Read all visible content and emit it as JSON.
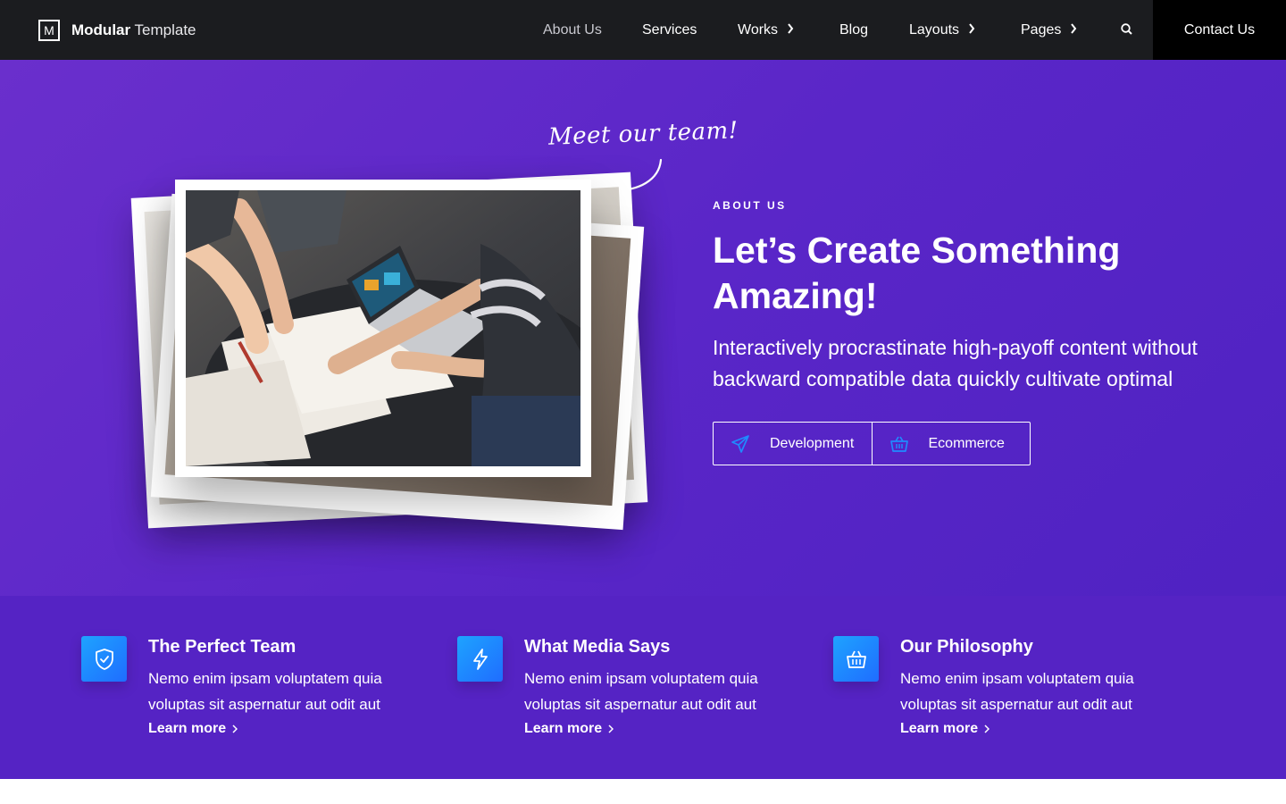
{
  "brand": {
    "logo_letter": "M",
    "name_bold": "Modular",
    "name_rest": " Template"
  },
  "nav": {
    "items": [
      {
        "label": "About Us",
        "has_submenu": false
      },
      {
        "label": "Services",
        "has_submenu": false
      },
      {
        "label": "Works",
        "has_submenu": true
      },
      {
        "label": "Blog",
        "has_submenu": false
      },
      {
        "label": "Layouts",
        "has_submenu": true
      },
      {
        "label": "Pages",
        "has_submenu": true
      }
    ],
    "search_icon": "search-icon",
    "cta": "Contact Us"
  },
  "hero": {
    "annotation": "Meet our team!",
    "eyebrow": "ABOUT US",
    "title_line1": "Let’s Create Something",
    "title_line2": "Amazing!",
    "description": "Interactively procrastinate high-payoff content without backward compatible data quickly cultivate optimal",
    "buttons": [
      {
        "label": "Development",
        "icon": "send-icon"
      },
      {
        "label": "Ecommerce",
        "icon": "basket-icon"
      }
    ],
    "photo_alt": "team-photo"
  },
  "features": [
    {
      "title": "The Perfect Team",
      "text": "Nemo enim ipsam voluptatem quia voluptas sit aspernatur aut odit aut",
      "link": "Learn more",
      "icon": "shield-check-icon"
    },
    {
      "title": "What Media Says",
      "text": "Nemo enim ipsam voluptatem quia voluptas sit aspernatur aut odit aut",
      "link": "Learn more",
      "icon": "lightning-icon"
    },
    {
      "title": "Our Philosophy",
      "text": "Nemo enim ipsam voluptatem quia voluptas sit aspernatur aut odit aut",
      "link": "Learn more",
      "icon": "basket-icon"
    }
  ],
  "colors": {
    "navbar": "#1b1c1f",
    "hero_purple": "#5a26c8",
    "features_purple": "#5523c4",
    "accent_blue": "#1f8bff"
  }
}
